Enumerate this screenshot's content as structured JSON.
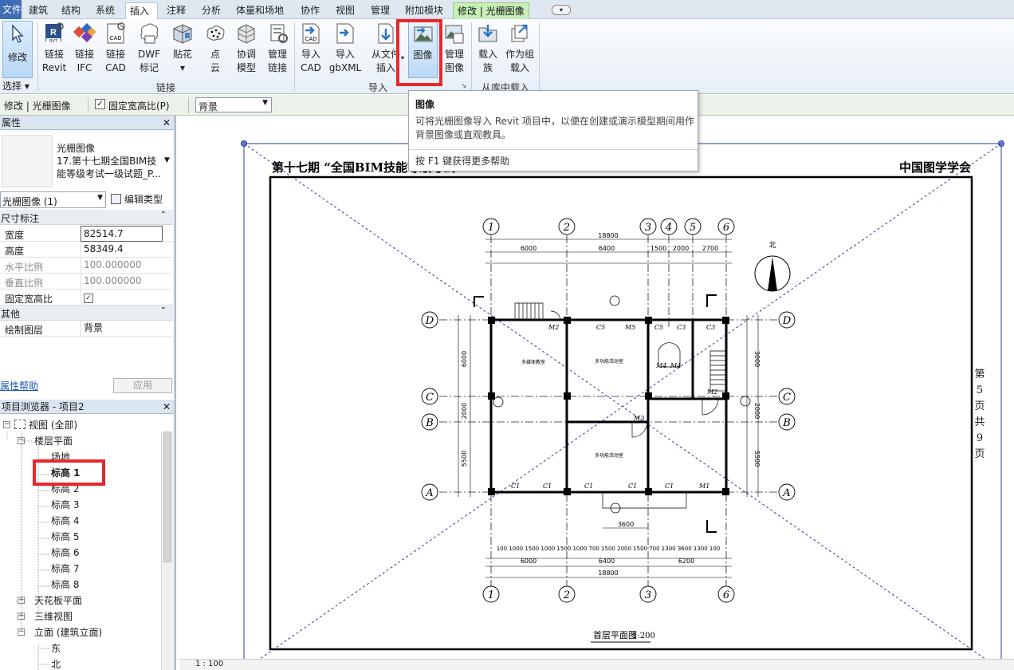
{
  "tabs": [
    "文件",
    "建筑",
    "结构",
    "系统",
    "插入",
    "注释",
    "分析",
    "体量和场地",
    "协作",
    "视图",
    "管理",
    "附加模块",
    "修改 | 光栅图像"
  ],
  "ribbon": {
    "modify_label": "修改",
    "select_label": "选择",
    "buttons": {
      "link_revit": [
        "链接",
        "Revit"
      ],
      "link_ifc": [
        "链接",
        "IFC"
      ],
      "link_cad": [
        "链接",
        "CAD"
      ],
      "dwf": [
        "DWF",
        "标记"
      ],
      "decal": [
        "贴花",
        ""
      ],
      "point_cloud": [
        "点",
        "云"
      ],
      "coordination_model": [
        "协调",
        "模型"
      ],
      "manage_links": [
        "管理",
        "链接"
      ],
      "import_cad": [
        "导入",
        "CAD"
      ],
      "import_gbxml": [
        "导入",
        "gbXML"
      ],
      "from_file": [
        "从文件",
        "插入"
      ],
      "image": [
        "图像",
        ""
      ],
      "manage_images": [
        "管理",
        "图像"
      ],
      "load_family": [
        "载入",
        "族"
      ],
      "load_as_group": [
        "作为组",
        "载入"
      ]
    },
    "groups": {
      "link": "链接",
      "import": "导入",
      "load_from_library": "从库中载入"
    }
  },
  "tooltip": {
    "title": "图像",
    "description": "可将光栅图像导入 Revit 项目中，以便在创建或演示模型期间用作背景图像或直观教具。",
    "help_prefix": "按 F1 键获得更多帮助",
    "help_key": "F1"
  },
  "options_bar": {
    "context_label": "修改 | 光栅图像",
    "lock_aspect_label": "固定宽高比(P)",
    "layer_value": "背景"
  },
  "properties": {
    "title": "属性",
    "type_name": "光栅图像",
    "type_desc": "17.第十七期全国BIM技能等级考试一级试题_P...",
    "selector_value": "光栅图像 (1)",
    "edit_type": "编辑类型",
    "section_dimensions": "尺寸标注",
    "rows": [
      {
        "key": "宽度",
        "value": "82514.7"
      },
      {
        "key": "高度",
        "value": "58349.4"
      },
      {
        "key": "水平比例",
        "value": "100.000000"
      },
      {
        "key": "垂直比例",
        "value": "100.000000"
      },
      {
        "key": "固定宽高比",
        "value": "✓"
      }
    ],
    "section_other": "其他",
    "other_rows": [
      {
        "key": "绘制图层",
        "value": "背景"
      }
    ],
    "help_link": "属性帮助",
    "apply": "应用"
  },
  "project_browser": {
    "title": "项目浏览器 - 项目2",
    "root": "视图 (全部)",
    "floor_plans": "楼层平面",
    "levels": [
      "场地",
      "标高 1",
      "标高 2",
      "标高 3",
      "标高 4",
      "标高 5",
      "标高 6",
      "标高 7",
      "标高 8"
    ],
    "ceiling_plans": "天花板平面",
    "views_3d": "三维视图",
    "elevations": "立面 (建筑立面)",
    "elevation_items": [
      "东",
      "北"
    ]
  },
  "drawing": {
    "header_left": "第十七期 “全国BIM技能等级考试",
    "header_right": "中国图学学会",
    "side_text": "第5页 共9页",
    "plan_title": "首层平面图",
    "plan_scale": "1:200",
    "axis_top": [
      "1",
      "2",
      "3",
      "4",
      "5",
      "6"
    ],
    "axis_bottom": [
      "1",
      "2",
      "3",
      "6"
    ],
    "axis_rows": [
      "D",
      "C",
      "B",
      "A"
    ],
    "dims_top_total": "18800",
    "dims_top_main": [
      "6000",
      "6400",
      "1500",
      "2000",
      "2700"
    ],
    "dims_bottom_main": [
      "6000",
      "6400",
      "6200"
    ],
    "dims_bottom_total": "18800",
    "dims_bottom_detail": "100 1000 1500 1000 1500 1000 700 1500 2000 1500 700 1300 3600 1300 100",
    "dims_left": [
      "6000",
      "2000",
      "5500"
    ],
    "dims_right": [
      "3000",
      "2000",
      "5500"
    ],
    "room_labels": [
      "多媒体教室",
      "多功能活动室",
      "多功能活动室"
    ],
    "north": "北",
    "labels": [
      "M2",
      "C5",
      "M5",
      "C5",
      "C3",
      "C3",
      "M1",
      "C1",
      "C1",
      "C1",
      "C1",
      "C1",
      "M2",
      "M3",
      "M4",
      "M4"
    ]
  },
  "status": {
    "scale": "1 : 100"
  }
}
